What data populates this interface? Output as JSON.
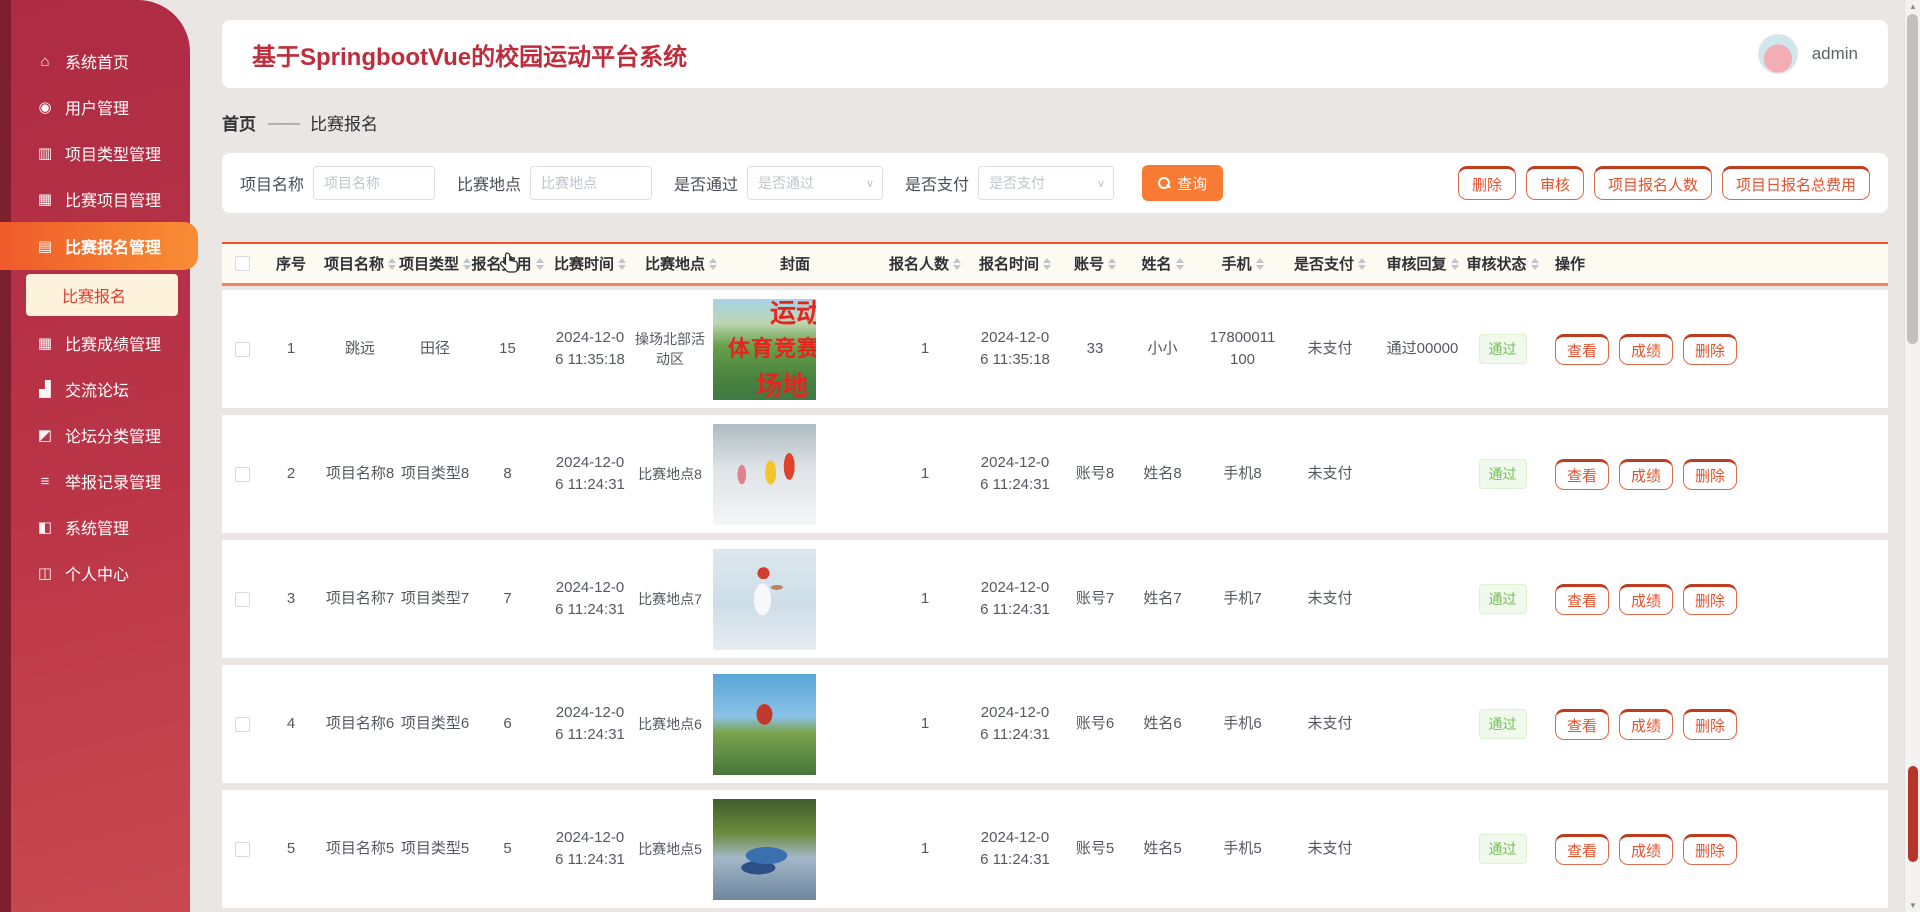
{
  "app": {
    "title": "基于SpringbootVue的校园运动平台系统",
    "user": "admin"
  },
  "sidebar": {
    "items_top": [
      {
        "label": "系统首页",
        "icon": "home-icon",
        "glyph": "⌂"
      },
      {
        "label": "用户管理",
        "icon": "user-icon",
        "glyph": "◉"
      },
      {
        "label": "项目类型管理",
        "icon": "category-icon",
        "glyph": "▥"
      },
      {
        "label": "比赛项目管理",
        "icon": "grid-icon",
        "glyph": "▦"
      },
      {
        "label": "比赛报名管理",
        "icon": "briefcase-icon",
        "glyph": "▤",
        "cls": "active"
      }
    ],
    "submenu_label": "比赛报名",
    "items_bottom": [
      {
        "label": "比赛成绩管理",
        "icon": "scores-grid-icon",
        "glyph": "▦"
      },
      {
        "label": "交流论坛",
        "icon": "bar-chart-icon",
        "glyph": "▟"
      },
      {
        "label": "论坛分类管理",
        "icon": "forum-category-icon",
        "glyph": "◩"
      },
      {
        "label": "举报记录管理",
        "icon": "report-list-icon",
        "glyph": "≡"
      },
      {
        "label": "系统管理",
        "icon": "system-book-icon",
        "glyph": "◧"
      },
      {
        "label": "个人中心",
        "icon": "profile-card-icon",
        "glyph": "◫"
      }
    ]
  },
  "breadcrumb": {
    "home": "首页",
    "separator": "——",
    "current": "比赛报名"
  },
  "filters": {
    "name_label": "项目名称",
    "name_placeholder": "项目名称",
    "location_label": "比赛地点",
    "location_placeholder": "比赛地点",
    "pass_label": "是否通过",
    "pass_placeholder": "是否通过",
    "pay_label": "是否支付",
    "pay_placeholder": "是否支付",
    "search_label": "查询"
  },
  "toolbar": {
    "buttons": [
      "删除",
      "审核",
      "项目报名人数",
      "项目日报名总费用"
    ]
  },
  "table": {
    "columns": [
      {
        "label": "序号",
        "sortable": false
      },
      {
        "label": "项目名称",
        "sortable": true
      },
      {
        "label": "项目类型",
        "sortable": true
      },
      {
        "label": "报名费用",
        "sortable": true
      },
      {
        "label": "比赛时间",
        "sortable": true
      },
      {
        "label": "比赛地点",
        "sortable": true
      },
      {
        "label": "封面",
        "sortable": false
      },
      {
        "label": "报名人数",
        "sortable": true
      },
      {
        "label": "报名时间",
        "sortable": true
      },
      {
        "label": "账号",
        "sortable": true
      },
      {
        "label": "姓名",
        "sortable": true
      },
      {
        "label": "手机",
        "sortable": true
      },
      {
        "label": "是否支付",
        "sortable": true
      },
      {
        "label": "审核回复",
        "sortable": true
      },
      {
        "label": "审核状态",
        "sortable": true
      },
      {
        "label": "操作",
        "sortable": false
      }
    ],
    "rows": [
      {
        "seq": "1",
        "name": "跳远",
        "type": "田径",
        "fee": "15",
        "match_time": "2024-12-06 11:35:18",
        "location": "操场北部活动区",
        "cover": "sports-poster",
        "cover_text_1": "运动",
        "cover_text_2": "体育竞赛",
        "cover_text_3": "场地",
        "count": "1",
        "reg_time": "2024-12-06 11:35:18",
        "account": "33",
        "username": "小小",
        "phone": "17800011100",
        "pay_status": "未支付",
        "audit_reply": "通过00000",
        "audit_status": "通过",
        "action_view": "查看",
        "action_score": "成绩",
        "action_delete": "删除"
      },
      {
        "seq": "2",
        "name": "项目名称8",
        "type": "项目类型8",
        "fee": "8",
        "match_time": "2024-12-06 11:24:31",
        "location": "比赛地点8",
        "cover": "ski-race",
        "count": "1",
        "reg_time": "2024-12-06 11:24:31",
        "account": "账号8",
        "username": "姓名8",
        "phone": "手机8",
        "pay_status": "未支付",
        "audit_reply": "",
        "audit_status": "通过",
        "action_view": "查看",
        "action_score": "成绩",
        "action_delete": "删除"
      },
      {
        "seq": "3",
        "name": "项目名称7",
        "type": "项目类型7",
        "fee": "7",
        "match_time": "2024-12-06 11:24:31",
        "location": "比赛地点7",
        "cover": "baseball",
        "count": "1",
        "reg_time": "2024-12-06 11:24:31",
        "account": "账号7",
        "username": "姓名7",
        "phone": "手机7",
        "pay_status": "未支付",
        "audit_reply": "",
        "audit_status": "通过",
        "action_view": "查看",
        "action_score": "成绩",
        "action_delete": "删除"
      },
      {
        "seq": "4",
        "name": "项目名称6",
        "type": "项目类型6",
        "fee": "6",
        "match_time": "2024-12-06 11:24:31",
        "location": "比赛地点6",
        "cover": "parkour",
        "count": "1",
        "reg_time": "2024-12-06 11:24:31",
        "account": "账号6",
        "username": "姓名6",
        "phone": "手机6",
        "pay_status": "未支付",
        "audit_reply": "",
        "audit_status": "通过",
        "action_view": "查看",
        "action_score": "成绩",
        "action_delete": "删除"
      },
      {
        "seq": "5",
        "name": "项目名称5",
        "type": "项目类型5",
        "fee": "5",
        "match_time": "2024-12-06 11:24:31",
        "location": "比赛地点5",
        "cover": "cycling",
        "count": "1",
        "reg_time": "2024-12-06 11:24:31",
        "account": "账号5",
        "username": "姓名5",
        "phone": "手机5",
        "pay_status": "未支付",
        "audit_reply": "",
        "audit_status": "通过",
        "action_view": "查看",
        "action_score": "成绩",
        "action_delete": "删除"
      }
    ]
  },
  "colors": {
    "sidebar_red": "#bb3547",
    "active_orange": "#f5802f",
    "accent_red": "#bf2c3c",
    "button_orange": "#f97a33",
    "outline_button": "#e2522d",
    "badge_green": "#70c153",
    "table_border_top": "#f4502a",
    "table_border_bottom": "#ee8566"
  }
}
